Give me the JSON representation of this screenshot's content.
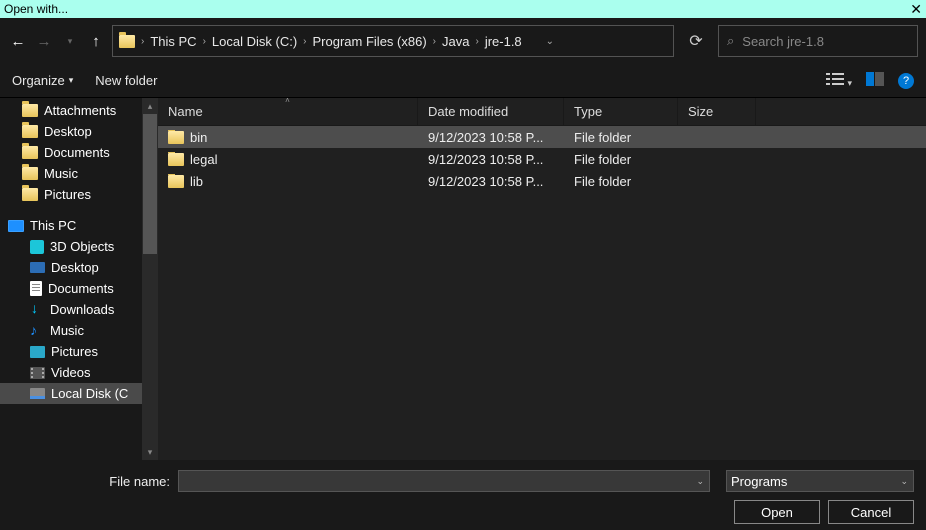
{
  "title": "Open with...",
  "breadcrumbs": [
    "This PC",
    "Local Disk (C:)",
    "Program Files (x86)",
    "Java",
    "jre-1.8"
  ],
  "search_placeholder": "Search jre-1.8",
  "toolbar": {
    "organize": "Organize",
    "newfolder": "New folder"
  },
  "help_glyph": "?",
  "sidebar": {
    "quick": [
      {
        "icon": "folder",
        "label": "Attachments"
      },
      {
        "icon": "folder",
        "label": "Desktop"
      },
      {
        "icon": "folder",
        "label": "Documents"
      },
      {
        "icon": "folder",
        "label": "Music"
      },
      {
        "icon": "folder",
        "label": "Pictures"
      }
    ],
    "thispc_label": "This PC",
    "thispc": [
      {
        "icon": "obj",
        "label": "3D Objects"
      },
      {
        "icon": "desktop",
        "label": "Desktop"
      },
      {
        "icon": "doc",
        "label": "Documents"
      },
      {
        "icon": "dl",
        "label": "Downloads"
      },
      {
        "icon": "music",
        "label": "Music"
      },
      {
        "icon": "pic",
        "label": "Pictures"
      },
      {
        "icon": "vid",
        "label": "Videos"
      },
      {
        "icon": "disk",
        "label": "Local Disk (C",
        "selected": true
      }
    ]
  },
  "columns": {
    "name": "Name",
    "date": "Date modified",
    "type": "Type",
    "size": "Size"
  },
  "files": [
    {
      "name": "bin",
      "date": "9/12/2023 10:58 P...",
      "type": "File folder",
      "selected": true
    },
    {
      "name": "legal",
      "date": "9/12/2023 10:58 P...",
      "type": "File folder"
    },
    {
      "name": "lib",
      "date": "9/12/2023 10:58 P...",
      "type": "File folder"
    }
  ],
  "footer": {
    "fn_label": "File name:",
    "fn_value": "",
    "filter": "Programs",
    "open": "Open",
    "cancel": "Cancel"
  }
}
